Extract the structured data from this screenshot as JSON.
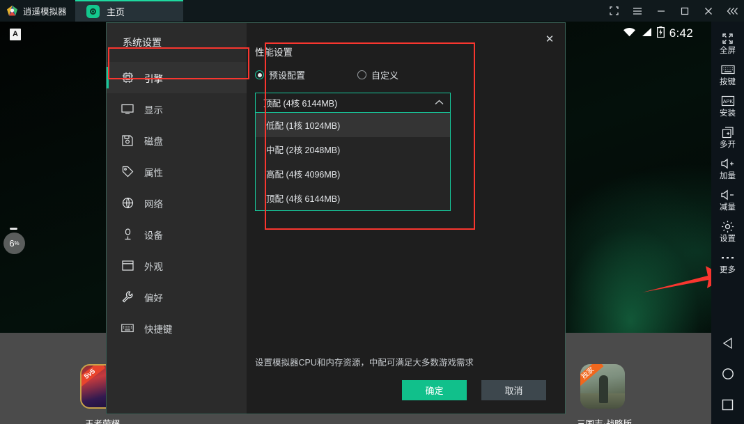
{
  "titlebar": {
    "brand_name": "逍遥模拟器",
    "brand_logo_icon": "memu-pentagon-logo",
    "tab": {
      "label": "主页",
      "icon": "home-circle-icon"
    },
    "window_controls": [
      {
        "name": "screenshot-button",
        "icon": "crop-frame-icon",
        "glyph": "⛶"
      },
      {
        "name": "menu-button",
        "icon": "hamburger-menu-icon",
        "glyph": "☰"
      },
      {
        "name": "minimize-button",
        "icon": "minimize-icon",
        "glyph": "—"
      },
      {
        "name": "maximize-button",
        "icon": "maximize-icon",
        "glyph": "▢"
      },
      {
        "name": "close-button",
        "icon": "close-x-icon",
        "glyph": "✕"
      },
      {
        "name": "collapse-sidebar-button",
        "icon": "chevrons-left-icon",
        "glyph": "«‹"
      }
    ]
  },
  "device": {
    "statusbar": {
      "time": "6:42",
      "wifi_icon": "wifi-icon",
      "signal_icon": "signal-bars-icon",
      "battery_icon": "battery-charging-icon"
    },
    "badge_a": "A",
    "progress_bubble": "6",
    "progress_bubble_unit": "%",
    "apps": [
      {
        "name": "王者荣耀",
        "badge": "5v5"
      },
      {
        "name": "三国志·战略版",
        "badge": "独家"
      }
    ]
  },
  "toolbar": {
    "items": [
      {
        "label": "全屏",
        "icon": "fullscreen-icon"
      },
      {
        "label": "按键",
        "icon": "keyboard-icon"
      },
      {
        "label": "安装",
        "icon": "apk-install-icon"
      },
      {
        "label": "多开",
        "icon": "multi-instance-icon"
      },
      {
        "label": "加量",
        "icon": "volume-up-icon"
      },
      {
        "label": "减量",
        "icon": "volume-down-icon"
      },
      {
        "label": "设置",
        "icon": "gear-icon"
      },
      {
        "label": "更多",
        "icon": "ellipsis-icon"
      }
    ],
    "nav": [
      {
        "name": "android-back-button",
        "icon": "back-triangle-icon"
      },
      {
        "name": "android-home-button",
        "icon": "home-circle-icon"
      },
      {
        "name": "android-recents-button",
        "icon": "recents-square-icon"
      }
    ]
  },
  "dialog": {
    "title": "系统设置",
    "close_glyph": "✕",
    "sidebar": [
      {
        "label": "引擎",
        "icon": "cpu-chip-icon",
        "active": true
      },
      {
        "label": "显示",
        "icon": "monitor-icon",
        "active": false
      },
      {
        "label": "磁盘",
        "icon": "floppy-disk-icon",
        "active": false
      },
      {
        "label": "属性",
        "icon": "tag-icon",
        "active": false
      },
      {
        "label": "网络",
        "icon": "globe-icon",
        "active": false
      },
      {
        "label": "设备",
        "icon": "device-icon",
        "active": false
      },
      {
        "label": "外观",
        "icon": "window-layout-icon",
        "active": false
      },
      {
        "label": "偏好",
        "icon": "wrench-icon",
        "active": false
      },
      {
        "label": "快捷键",
        "icon": "keyboard-icon",
        "active": false
      }
    ],
    "performance": {
      "section_title": "性能设置",
      "radios": [
        {
          "label": "预设配置",
          "selected": true
        },
        {
          "label": "自定义",
          "selected": false
        }
      ],
      "select_value": "顶配 (4核 6144MB)",
      "select_chevron": "⌃",
      "options": [
        {
          "label": "低配 (1核 1024MB)",
          "hovered": true
        },
        {
          "label": "中配 (2核 2048MB)",
          "hovered": false
        },
        {
          "label": "高配 (4核 4096MB)",
          "hovered": false
        },
        {
          "label": "顶配 (4核 6144MB)",
          "hovered": false
        }
      ]
    },
    "hint": "设置模拟器CPU和内存资源，中配可满足大多数游戏需求",
    "buttons": {
      "ok": "确定",
      "cancel": "取消"
    }
  },
  "colors": {
    "accent_green": "#16c79a",
    "annotation_red": "#f9362f",
    "dialog_bg": "#1e1e1e",
    "sidebar_bg": "#2b2b2b"
  }
}
